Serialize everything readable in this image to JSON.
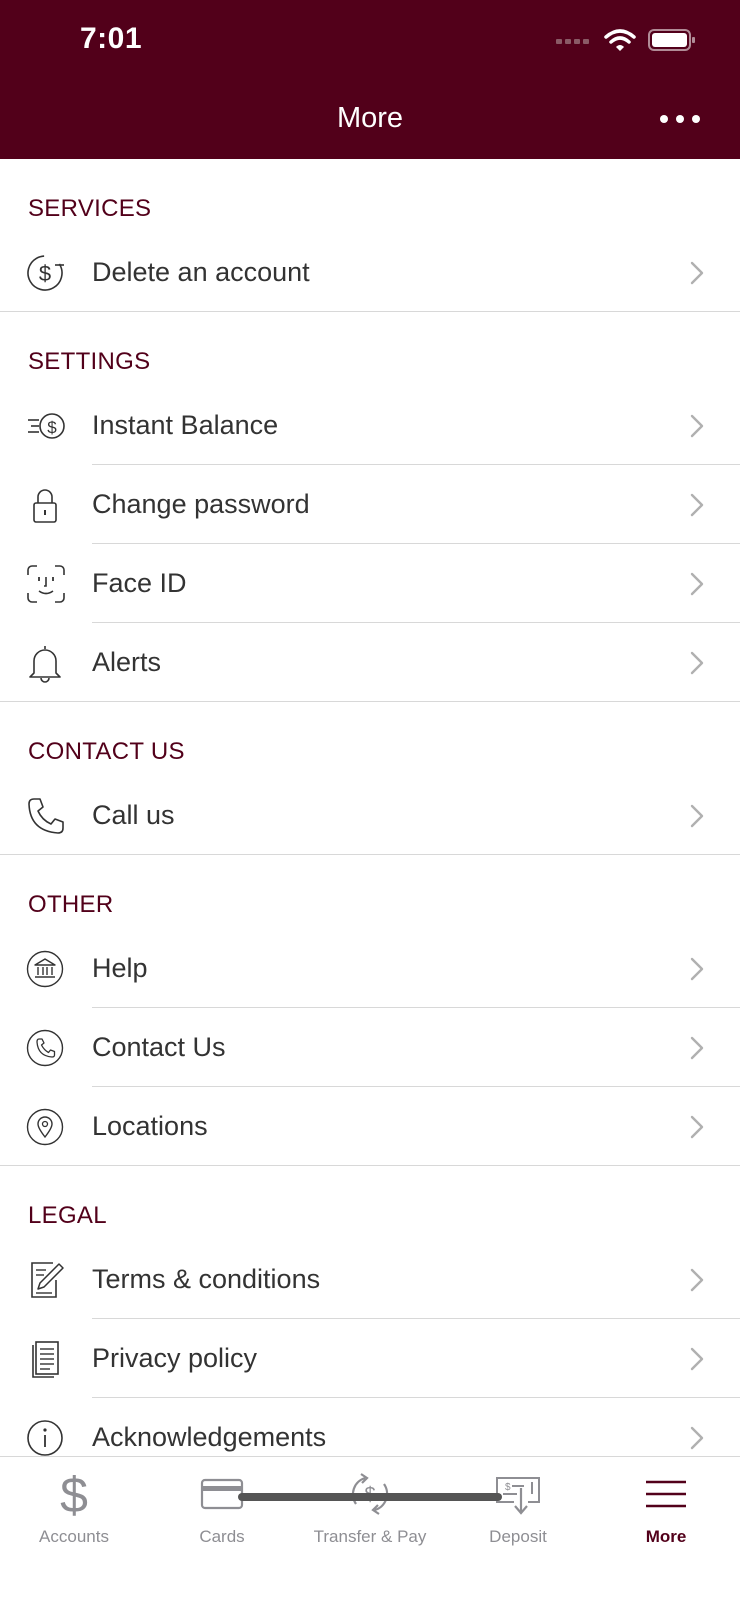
{
  "status": {
    "time": "7:01"
  },
  "header": {
    "title": "More",
    "menu_icon": "more-horizontal-icon"
  },
  "colors": {
    "brand": "#52001a",
    "text": "#333333",
    "separator": "#d8d8d8",
    "inactive": "#8e8e93"
  },
  "sections": {
    "services": {
      "title": "SERVICES",
      "items": [
        {
          "label": "Delete an account",
          "icon": "dollar-minus-icon"
        }
      ]
    },
    "settings": {
      "title": "SETTINGS",
      "items": [
        {
          "label": "Instant Balance",
          "icon": "fast-dollar-icon"
        },
        {
          "label": "Change password",
          "icon": "lock-icon"
        },
        {
          "label": "Face ID",
          "icon": "face-id-icon"
        },
        {
          "label": "Alerts",
          "icon": "bell-icon"
        }
      ]
    },
    "contact": {
      "title": "CONTACT US",
      "items": [
        {
          "label": "Call us",
          "icon": "phone-icon"
        }
      ]
    },
    "other": {
      "title": "OTHER",
      "items": [
        {
          "label": "Help",
          "icon": "bank-icon"
        },
        {
          "label": "Contact Us",
          "icon": "phone-circle-icon"
        },
        {
          "label": "Locations",
          "icon": "location-pin-icon"
        }
      ]
    },
    "legal": {
      "title": "LEGAL",
      "items": [
        {
          "label": "Terms & conditions",
          "icon": "pen-document-icon"
        },
        {
          "label": "Privacy policy",
          "icon": "document-icon"
        },
        {
          "label": "Acknowledgements",
          "icon": "info-icon"
        }
      ]
    }
  },
  "tabbar": {
    "tabs": [
      {
        "label": "Accounts",
        "icon": "dollar-icon",
        "active": false
      },
      {
        "label": "Cards",
        "icon": "card-icon",
        "active": false
      },
      {
        "label": "Transfer & Pay",
        "icon": "transfer-icon",
        "active": false
      },
      {
        "label": "Deposit",
        "icon": "check-deposit-icon",
        "active": false
      },
      {
        "label": "More",
        "icon": "menu-icon",
        "active": true
      }
    ]
  }
}
